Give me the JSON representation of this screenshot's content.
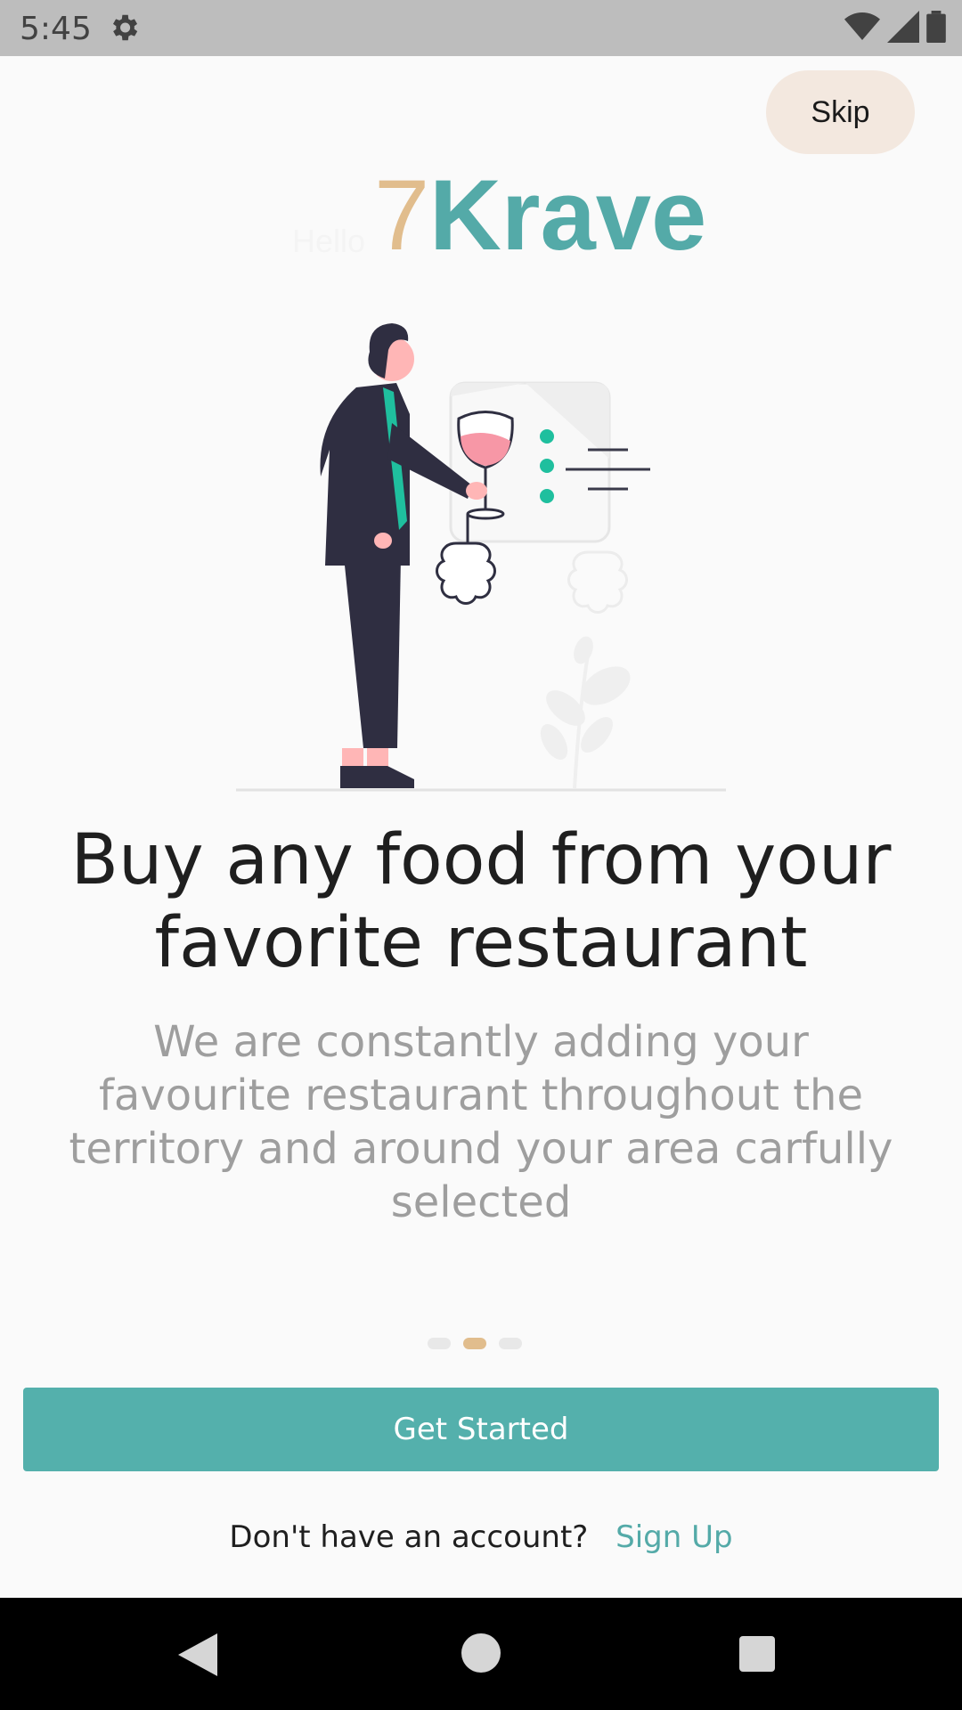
{
  "status_bar": {
    "time": "5:45",
    "icons": [
      "settings-gear-icon",
      "wifi-icon",
      "cell-signal-icon",
      "battery-icon"
    ]
  },
  "skip_label": "Skip",
  "logo": {
    "hello": "Hello",
    "seven": "7",
    "krave": "Krave"
  },
  "headline": "Buy any food from your favorite restaurant",
  "subtext": "We are constantly adding your favourite restaurant throughout the territory and around your area carfully selected",
  "pager": {
    "total": 3,
    "active_index": 1
  },
  "get_started_label": "Get Started",
  "signup": {
    "question": "Don't have an account?",
    "link": "Sign Up"
  },
  "colors": {
    "accent_teal": "#54aaa8",
    "accent_tan": "#e1bd8d",
    "skip_bg": "#f3e8df",
    "button_bg": "#54b0ac"
  },
  "nav_bar": {
    "icons": [
      "back-icon",
      "home-icon",
      "recents-icon"
    ]
  }
}
